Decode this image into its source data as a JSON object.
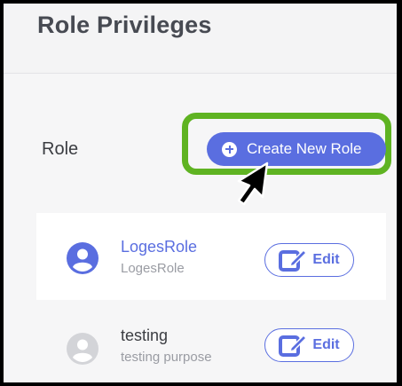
{
  "header": {
    "title": "Role Privileges"
  },
  "section": {
    "label": "Role"
  },
  "actions": {
    "create_label": "Create New Role"
  },
  "roles": [
    {
      "name": "LogesRole",
      "description": "LogesRole",
      "edit_label": "Edit",
      "selected": true,
      "avatar_color": "#5a6ee0"
    },
    {
      "name": "testing",
      "description": "testing purpose",
      "edit_label": "Edit",
      "selected": false,
      "avatar_color": "#d3d4d8"
    }
  ],
  "colors": {
    "accent": "#5a6ee0",
    "highlight": "#5fb322",
    "text": "#3b3d42",
    "muted": "#9a9ca3"
  },
  "icons": {
    "create": "plus-circle-icon",
    "edit": "edit-pencil-icon",
    "avatar": "user-avatar-icon",
    "cursor": "mouse-pointer-icon"
  }
}
